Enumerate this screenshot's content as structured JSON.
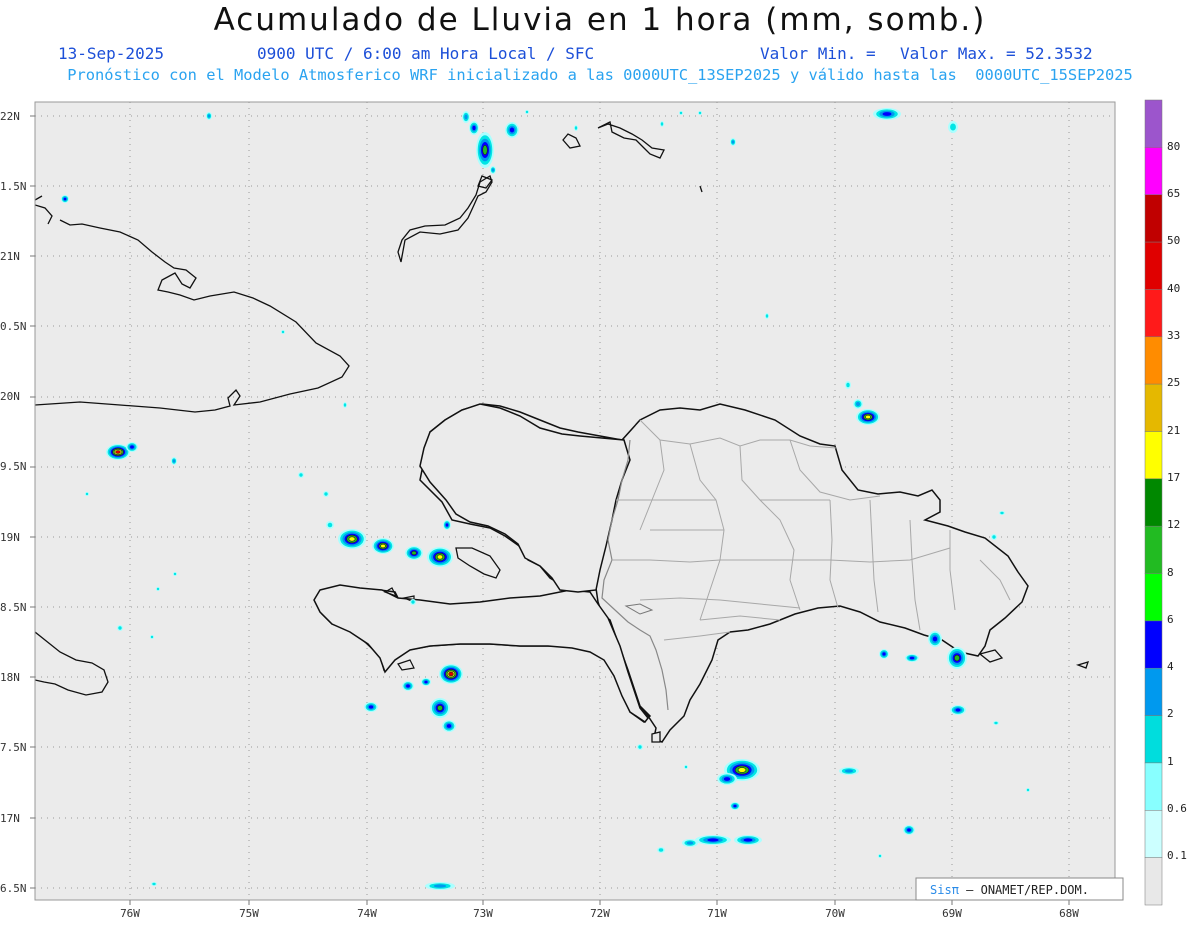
{
  "header": {
    "title": "Acumulado de Lluvia en 1 hora (mm, somb.)",
    "date": "13-Sep-2025",
    "time_info": "0900 UTC / 6:00 am Hora Local / SFC",
    "valor_min_label": "Valor Min. =",
    "valor_max_label": "Valor Max. = 52.3532",
    "model_info": "Pronóstico con el Modelo Atmosferico WRF inicializado a las 0000UTC_13SEP2025 y válido hasta las  0000UTC_15SEP2025"
  },
  "map": {
    "lat_labels": [
      "22N",
      "1.5N",
      "21N",
      "0.5N",
      "20N",
      "9.5N",
      "19N",
      "8.5N",
      "18N",
      "7.5N",
      "17N",
      "6.5N"
    ],
    "lon_labels": [
      "76W",
      "75W",
      "74W",
      "73W",
      "72W",
      "71W",
      "70W",
      "69W",
      "68W"
    ],
    "background": "#ebebeb",
    "credit_prefix": "Sis",
    "credit_pi": "π",
    "credit_suffix": " – ONAMET/REP.DOM."
  },
  "legend": {
    "levels": [
      "80",
      "65",
      "50",
      "40",
      "33",
      "25",
      "21",
      "17",
      "12",
      "8",
      "6",
      "4",
      "2",
      "1",
      "0.6",
      "0.1"
    ],
    "colors": [
      "#9c55cc",
      "#ff00ff",
      "#c00000",
      "#e00000",
      "#ff1a1a",
      "#ff8c00",
      "#e5b800",
      "#ffff00",
      "#008800",
      "#22bb22",
      "#00ff00",
      "#0000ff",
      "#0099ee",
      "#00dddd",
      "#88ffff",
      "#ccffff",
      "#e8e8e8"
    ]
  }
}
